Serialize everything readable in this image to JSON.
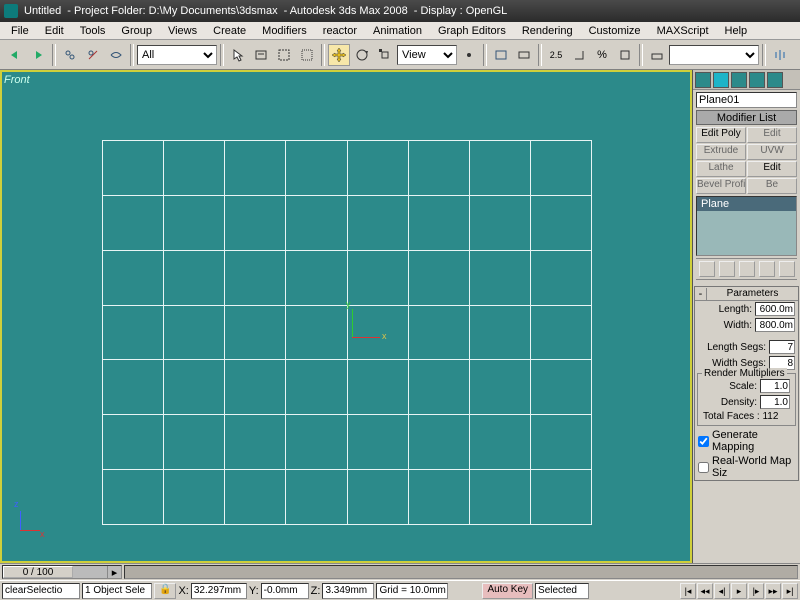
{
  "title": {
    "doc": "Untitled",
    "project": "- Project Folder: D:\\My Documents\\3dsmax",
    "app": "- Autodesk 3ds Max 2008",
    "display": "- Display : OpenGL"
  },
  "menu": [
    "File",
    "Edit",
    "Tools",
    "Group",
    "Views",
    "Create",
    "Modifiers",
    "reactor",
    "Animation",
    "Graph Editors",
    "Rendering",
    "Customize",
    "MAXScript",
    "Help"
  ],
  "toolbar": {
    "selection_filter": "All",
    "named_selection": "",
    "ref_coord": "View"
  },
  "viewport": {
    "label": "Front"
  },
  "sidepanel": {
    "object_name": "Plane01",
    "modifier_list_label": "Modifier List",
    "buttons": [
      {
        "label": "Edit Poly",
        "enabled": true
      },
      {
        "label": "Edit",
        "enabled": false
      },
      {
        "label": "Extrude",
        "enabled": false
      },
      {
        "label": "UVW",
        "enabled": false
      },
      {
        "label": "Lathe",
        "enabled": false
      },
      {
        "label": "Edit",
        "enabled": true
      },
      {
        "label": "Bevel Profile",
        "enabled": false
      },
      {
        "label": "Be",
        "enabled": false
      }
    ],
    "stack_item": "Plane",
    "parameters": {
      "title": "Parameters",
      "length_label": "Length:",
      "length": "600.0m",
      "width_label": "Width:",
      "width": "800.0m",
      "lsegs_label": "Length Segs:",
      "lsegs": "7",
      "wsegs_label": "Width Segs:",
      "wsegs": "8",
      "render_mult_label": "Render Multipliers",
      "scale_label": "Scale:",
      "scale": "1.0",
      "density_label": "Density:",
      "density": "1.0",
      "total_faces_label": "Total Faces : 112",
      "gen_mapping_label": "Generate Mapping",
      "real_world_label": "Real-World Map Siz",
      "gen_mapping_checked": true,
      "real_world_checked": false
    }
  },
  "time": {
    "slider": "0 / 100"
  },
  "status": {
    "script": "clearSelectio",
    "objsel": "1 Object Sele",
    "x_lbl": "X:",
    "x": "32.297mm",
    "y_lbl": "Y:",
    "y": "-0.0mm",
    "z_lbl": "Z:",
    "z": "3.349mm",
    "grid": "Grid = 10.0mm",
    "autokey": "Auto Key",
    "keymode": "Selected"
  }
}
